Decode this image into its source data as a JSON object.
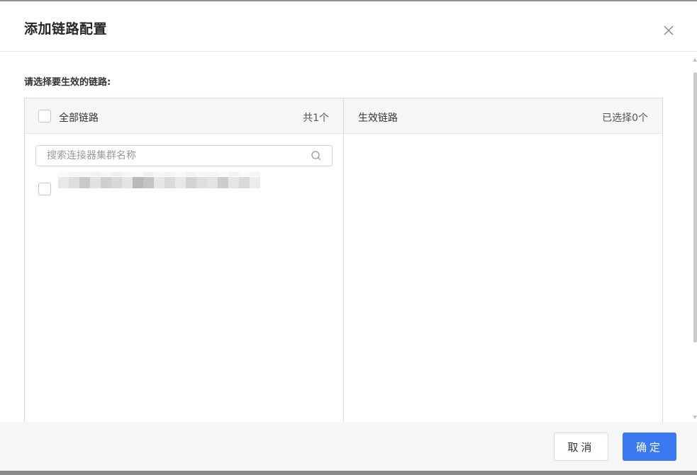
{
  "dialog": {
    "title": "添加链路配置",
    "close_icon": "close-icon",
    "section_label": "请选择要生效的链路:"
  },
  "transfer": {
    "left": {
      "header_label": "全部链路",
      "count": "共1个",
      "search_placeholder": "搜索连接器集群名称",
      "search_icon": "search-icon",
      "items": [
        {
          "checked": false,
          "label_redacted": true
        }
      ]
    },
    "right": {
      "header_label": "生效链路",
      "count": "已选择0个",
      "items": []
    }
  },
  "footer": {
    "cancel_label": "取消",
    "ok_label": "确定"
  },
  "colors": {
    "primary": "#3a78f2",
    "panel_header_bg": "#f5f6f8",
    "border": "#dcdcdc"
  }
}
